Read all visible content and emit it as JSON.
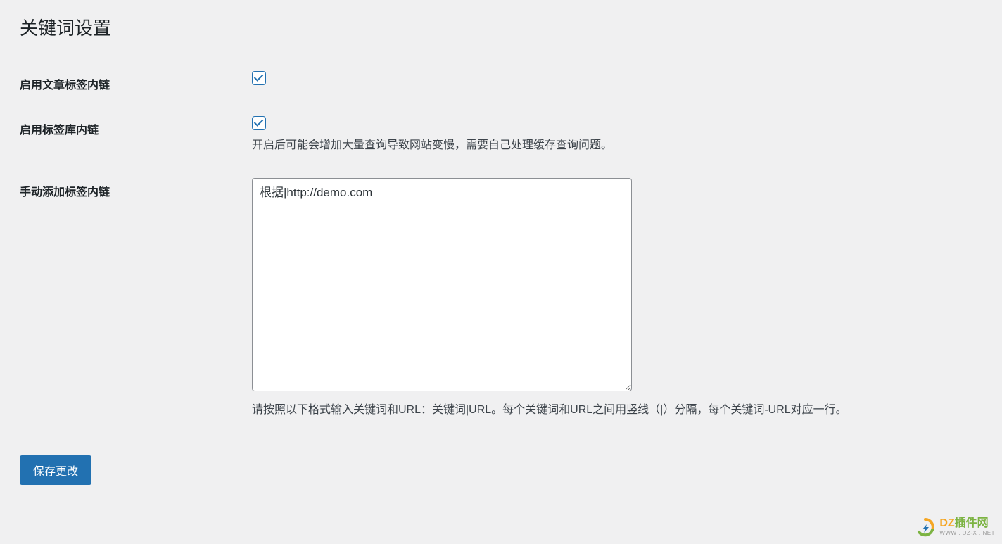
{
  "page": {
    "title": "关键词设置"
  },
  "fields": {
    "enable_article_tag_link": {
      "label": "启用文章标签内链",
      "checked": true
    },
    "enable_tag_library_link": {
      "label": "启用标签库内链",
      "checked": true,
      "description": "开启后可能会增加大量查询导致网站变慢，需要自己处理缓存查询问题。"
    },
    "manual_tag_links": {
      "label": "手动添加标签内链",
      "value": "根据|http://demo.com",
      "description": "请按照以下格式输入关键词和URL：关键词|URL。每个关键词和URL之间用竖线（|）分隔，每个关键词-URL对应一行。"
    }
  },
  "actions": {
    "save": "保存更改"
  },
  "watermark": {
    "brand_part1": "DZ",
    "brand_part2": "插件网",
    "sub": "WWW . DZ-X . NET"
  }
}
